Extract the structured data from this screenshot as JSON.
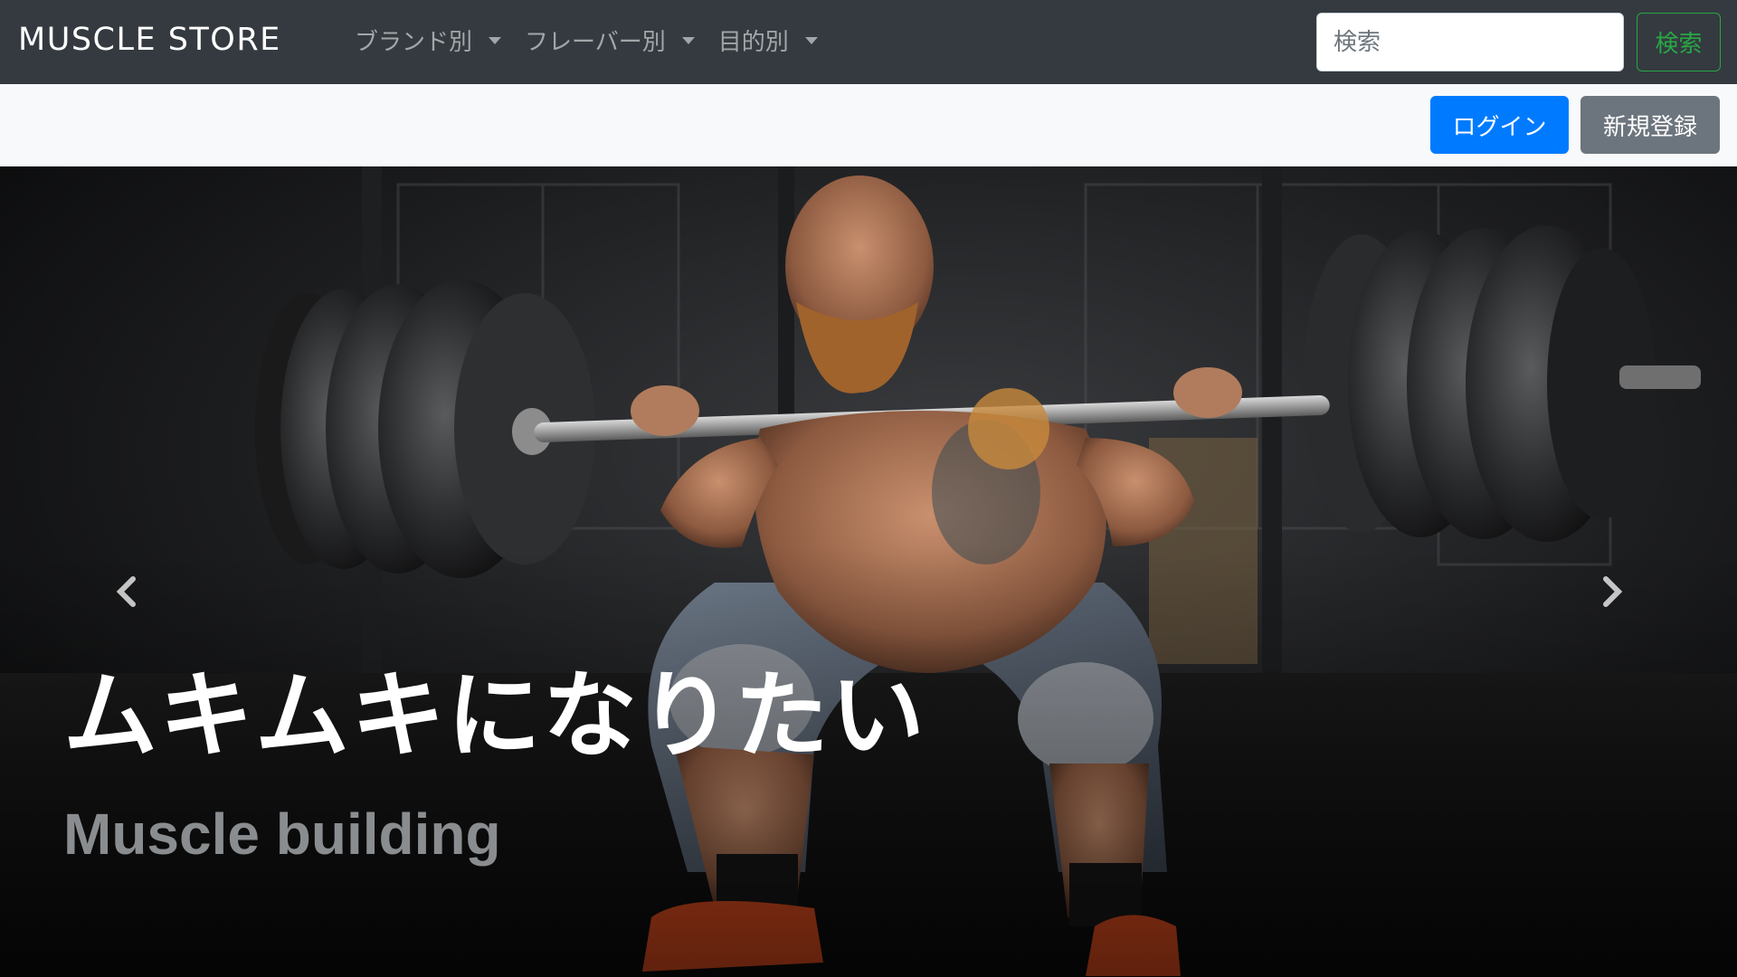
{
  "navbar": {
    "brand": "MUSCLE STORE",
    "menus": [
      {
        "label": "ブランド別"
      },
      {
        "label": "フレーバー別"
      },
      {
        "label": "目的別"
      }
    ],
    "search": {
      "placeholder": "検索",
      "value": "",
      "button_label": "検索"
    }
  },
  "subbar": {
    "login_label": "ログイン",
    "register_label": "新規登録"
  },
  "carousel": {
    "caption_title": "ムキムキになりたい",
    "caption_subtitle": "Muscle building",
    "prev_icon": "chevron-left-icon",
    "next_icon": "chevron-right-icon"
  },
  "colors": {
    "navbar_bg": "#343a40",
    "subbar_bg": "#f8f9fa",
    "primary": "#007bff",
    "secondary": "#6c757d",
    "success": "#28a745"
  }
}
